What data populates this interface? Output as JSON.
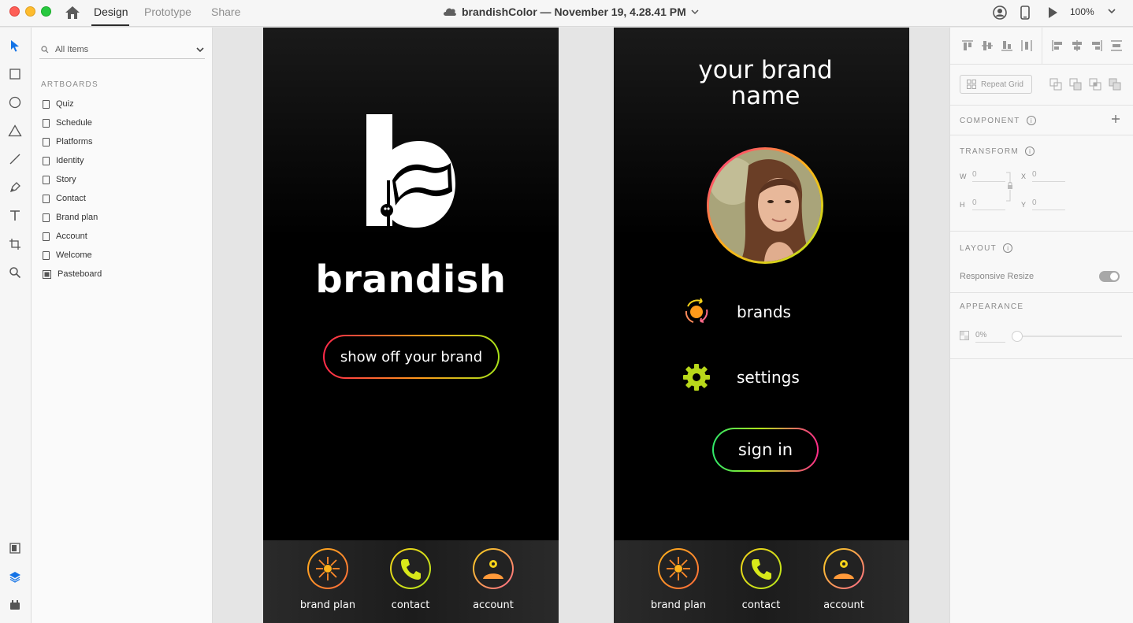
{
  "titlebar": {
    "tabs": [
      {
        "label": "Design",
        "active": true
      },
      {
        "label": "Prototype",
        "active": false
      },
      {
        "label": "Share",
        "active": false
      }
    ],
    "document_title": "brandishColor — November 19, 4.28.41 PM",
    "zoom": "100%"
  },
  "layers_panel": {
    "search_placeholder": "All Items",
    "section_title": "ARTBOARDS",
    "items": [
      "Quiz",
      "Schedule",
      "Platforms",
      "Identity",
      "Story",
      "Contact",
      "Brand plan",
      "Account",
      "Welcome",
      "Pasteboard"
    ]
  },
  "artboard_welcome": {
    "brand_word": "brandish",
    "cta_label": "show off your brand"
  },
  "artboard_account": {
    "heading": "your brand name",
    "menu": [
      {
        "label": "brands",
        "icon": "brands-cycle-icon"
      },
      {
        "label": "settings",
        "icon": "gear-icon"
      }
    ],
    "signin_label": "sign in"
  },
  "bottom_nav": [
    {
      "label": "brand plan",
      "icon": "brand-plan-icon"
    },
    {
      "label": "contact",
      "icon": "phone-icon"
    },
    {
      "label": "account",
      "icon": "account-icon"
    }
  ],
  "properties": {
    "repeat_grid": "Repeat Grid",
    "component": "COMPONENT",
    "transform": "TRANSFORM",
    "w_label": "W",
    "w_value": "0",
    "h_label": "H",
    "h_value": "0",
    "x_label": "X",
    "x_value": "0",
    "y_label": "Y",
    "y_value": "0",
    "layout": "LAYOUT",
    "responsive_resize": "Responsive Resize",
    "appearance": "APPEARANCE",
    "opacity": "0%"
  },
  "colors": {
    "accent_yellow": "#f5d21a",
    "accent_orange": "#ff9a1a",
    "accent_pink": "#ff2a8a",
    "accent_green": "#a8e21a",
    "selection_blue": "#1473e6"
  }
}
